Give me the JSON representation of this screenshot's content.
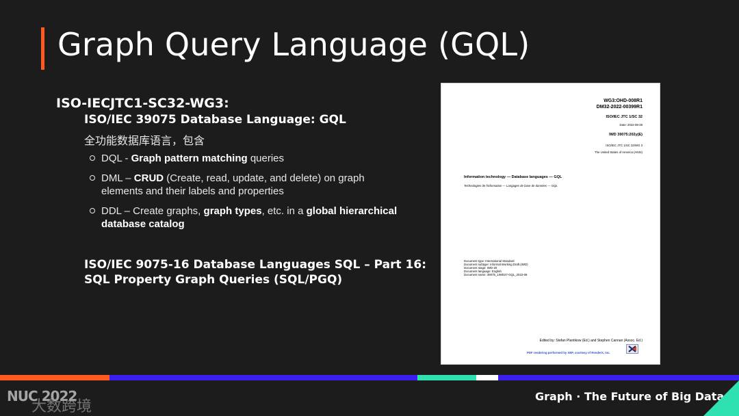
{
  "slide": {
    "title": "Graph Query Language (GQL)",
    "org": "ISO-IECJTC1-SC32-WG3:",
    "standard_gql": "ISO/IEC 39075 Database Language: GQL",
    "chinese_note": "全功能数据库语言，包含",
    "bullets": [
      {
        "prefix": "DQL - ",
        "bold": "Graph pattern matching",
        "suffix": " queries"
      },
      {
        "prefix": "DML – ",
        "bold": "CRUD",
        "suffix": " (Create, read, update, and delete) on graph elements and their labels and properties"
      },
      {
        "prefix": "DDL – Create graphs, ",
        "bold": "graph types",
        "mid": ", etc. in a ",
        "bold2": "global hierarchical database catalog"
      }
    ],
    "sql_line1": "ISO/IEC 9075-16 Database Languages SQL – Part 16:",
    "sql_line2": "SQL Property Graph Queries (SQL/PGQ)"
  },
  "document": {
    "id1": "WG3:OHD-008R1",
    "id2": "DM32-2022-00399R1",
    "committee": "ISO/IEC JTC 1/SC 32",
    "date": "Date: 2022-08-28",
    "iwd": "IWD 39075:202y(E)",
    "secretariat": "ISO/IEC JTC 1/SC 32/WG 3",
    "country": "The United States of America (ANSI)",
    "title_en": "Information technology — Database languages — GQL",
    "title_fr": "Technologies de l'information — Langages de base de données — GQL",
    "meta": [
      "Document type: International Standard",
      "Document subtype: Informal Working Draft (IWD)",
      "Document stage: IWD-20",
      "Document language: English",
      "Document name: 39075_1IWD27-GQL_2022-08"
    ],
    "editors": "Edited by: Stefan Plantikow (Ed.) and Stephen Cannan (Assoc. Ed.)",
    "pdf_note": "PDF rendering performed by XEP, courtesy of RenderX, Inc."
  },
  "footer": {
    "logo": "NUC 2022",
    "watermark": "大数跨境",
    "tagline": "Graph · The Future of Big Data"
  },
  "colors": {
    "accent": "#ff5a1f",
    "stripe_blue": "#3a1ff0",
    "stripe_teal": "#2fe0b0",
    "background": "#1c1c1c"
  }
}
